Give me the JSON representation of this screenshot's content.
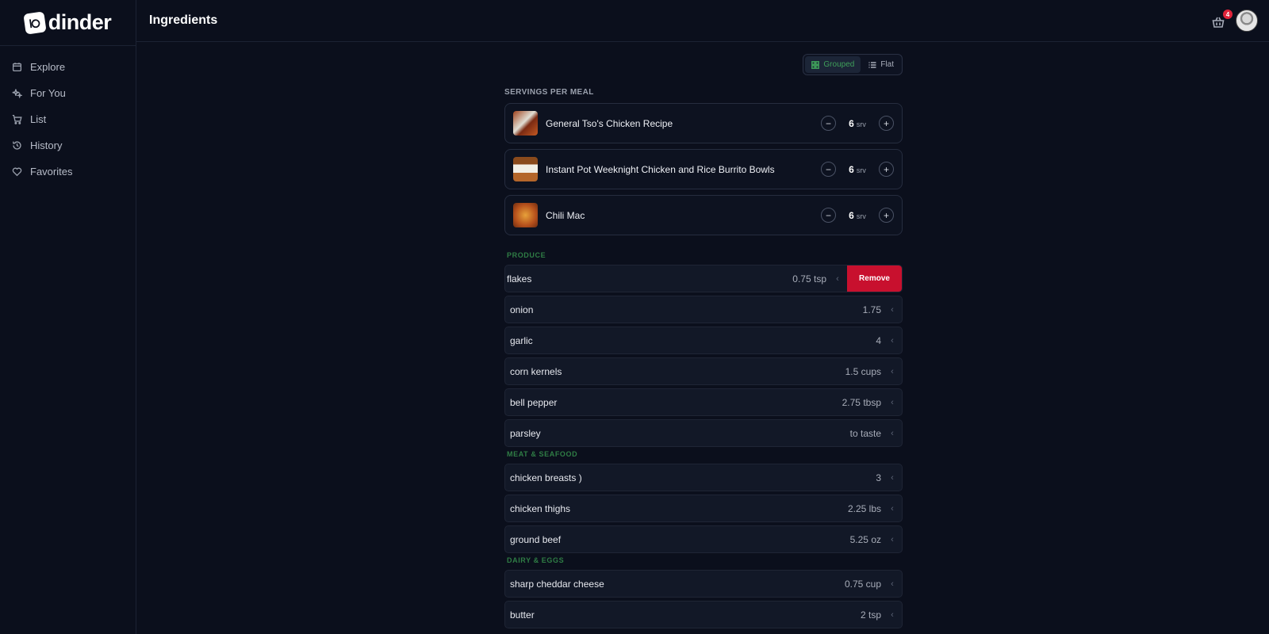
{
  "app": {
    "brand": "dinder",
    "page_title": "Ingredients"
  },
  "sidebar": {
    "items": [
      {
        "label": "Explore",
        "icon": "calendar-icon"
      },
      {
        "label": "For You",
        "icon": "sparkles-icon"
      },
      {
        "label": "List",
        "icon": "cart-icon"
      },
      {
        "label": "History",
        "icon": "history-icon"
      },
      {
        "label": "Favorites",
        "icon": "heart-icon"
      }
    ]
  },
  "header": {
    "cart_count": "4"
  },
  "view_toggle": {
    "grouped_label": "Grouped",
    "flat_label": "Flat",
    "active": "grouped"
  },
  "servings": {
    "label": "SERVINGS PER MEAL",
    "unit": "srv",
    "recipes": [
      {
        "name": "General Tso's Chicken Recipe",
        "servings": "6"
      },
      {
        "name": "Instant Pot Weeknight Chicken and Rice Burrito Bowls",
        "servings": "6"
      },
      {
        "name": "Chili Mac",
        "servings": "6"
      }
    ]
  },
  "remove_label": "Remove",
  "categories": [
    {
      "label": "PRODUCE",
      "items": [
        {
          "name": "flakes",
          "amount": "0.75 tsp",
          "swiped": true
        },
        {
          "name": "onion",
          "amount": "1.75"
        },
        {
          "name": "garlic",
          "amount": "4"
        },
        {
          "name": "corn kernels",
          "amount": "1.5 cups"
        },
        {
          "name": "bell pepper",
          "amount": "2.75 tbsp"
        },
        {
          "name": "parsley",
          "amount": "to taste"
        }
      ]
    },
    {
      "label": "MEAT & SEAFOOD",
      "items": [
        {
          "name": "chicken breasts )",
          "amount": "3"
        },
        {
          "name": "chicken thighs",
          "amount": "2.25 lbs"
        },
        {
          "name": "ground beef",
          "amount": "5.25 oz"
        }
      ]
    },
    {
      "label": "DAIRY & EGGS",
      "items": [
        {
          "name": "sharp cheddar cheese",
          "amount": "0.75 cup"
        },
        {
          "name": "butter",
          "amount": "2 tsp"
        }
      ]
    }
  ],
  "colors": {
    "accent": "#3f9f5a",
    "danger": "#c8102e",
    "background": "#0b0f1c"
  }
}
